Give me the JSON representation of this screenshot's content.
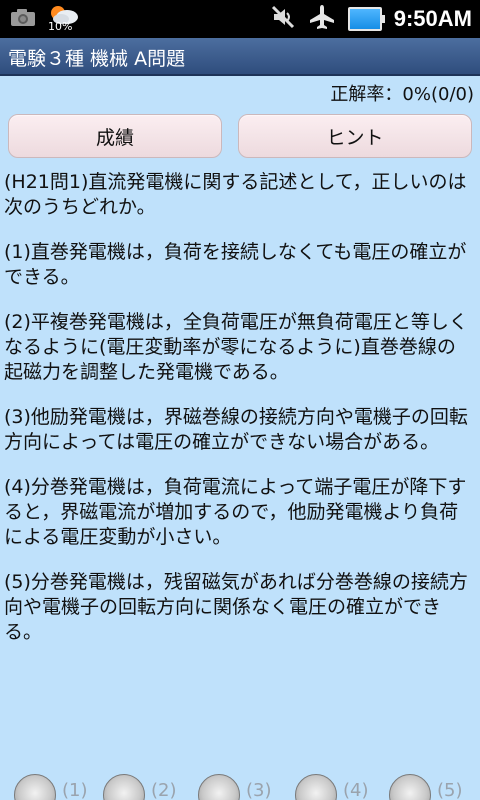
{
  "status_bar": {
    "icons_left": [
      "camera-icon",
      "weather-icon"
    ],
    "weather_percent": "10%",
    "icons_right": [
      "mute-icon",
      "airplane-icon",
      "battery-icon"
    ],
    "time": "9:50AM"
  },
  "titlebar": {
    "title": "電験３種 機械 A問題"
  },
  "score": {
    "text": "正解率：0%(0/0)"
  },
  "buttons": {
    "score_label": "成績",
    "hint_label": "ヒント"
  },
  "question": {
    "stem": "(H21問1)直流発電機に関する記述として，正しいのは次のうちどれか。",
    "choices": [
      "(1)直巻発電機は，負荷を接続しなくても電圧の確立ができる。",
      "(2)平複巻発電機は，全負荷電圧が無負荷電圧と等しくなるように(電圧変動率が零になるように)直巻巻線の起磁力を調整した発電機である。",
      "(3)他励発電機は，界磁巻線の接続方向や電機子の回転方向によっては電圧の確立ができない場合がある。",
      "(4)分巻発電機は，負荷電流によって端子電圧が降下すると，界磁電流が増加するので，他励発電機より負荷による電圧変動が小さい。",
      "(5)分巻発電機は，残留磁気があれば分巻巻線の接続方向や電機子の回転方向に関係なく電圧の確立ができる。"
    ]
  },
  "answer_options": [
    "(1)",
    "(2)",
    "(3)",
    "(4)",
    "(5)"
  ],
  "colors": {
    "content_bg": "#bfe1fb",
    "titlebar_bg": "#3f5f8f",
    "button_bg": "#f4e4e8",
    "status_bg": "#000000"
  }
}
